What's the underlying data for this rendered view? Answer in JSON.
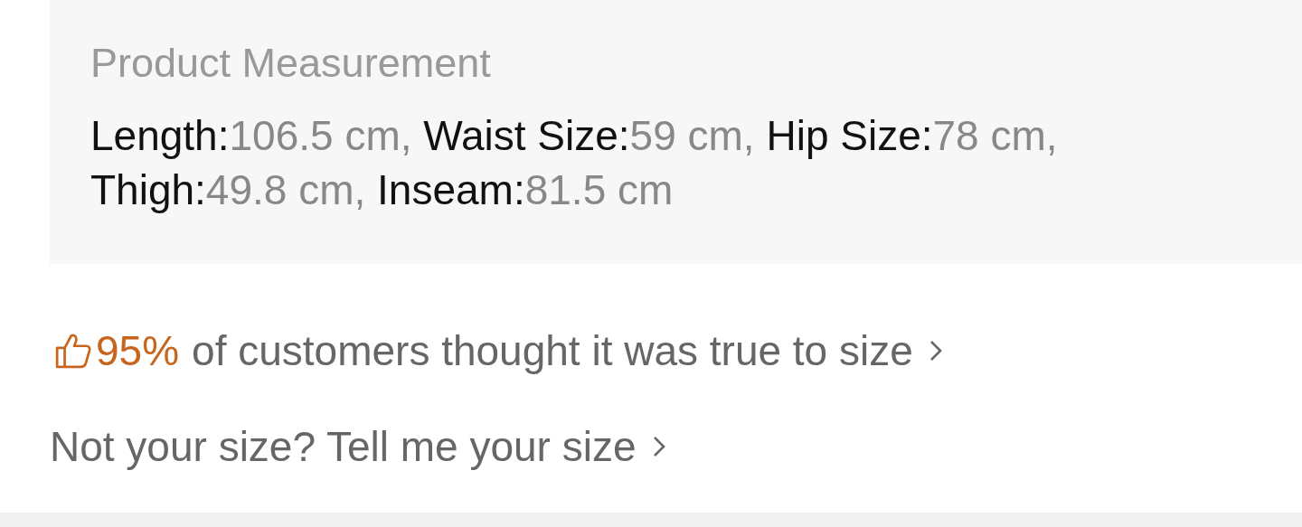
{
  "measurement_panel": {
    "title": "Product Measurement",
    "items": [
      {
        "label": "Length:",
        "value": "106.5 cm,"
      },
      {
        "label": "Waist Size:",
        "value": "59 cm,"
      },
      {
        "label": "Hip Size:",
        "value": "78 cm,"
      },
      {
        "label": "Thigh:",
        "value": "49.8 cm,"
      },
      {
        "label": "Inseam:",
        "value": "81.5 cm"
      }
    ]
  },
  "fit_summary": {
    "percent": "95%",
    "text": "of customers thought it was true to size"
  },
  "size_link": {
    "text": "Not your size? Tell me your size"
  }
}
